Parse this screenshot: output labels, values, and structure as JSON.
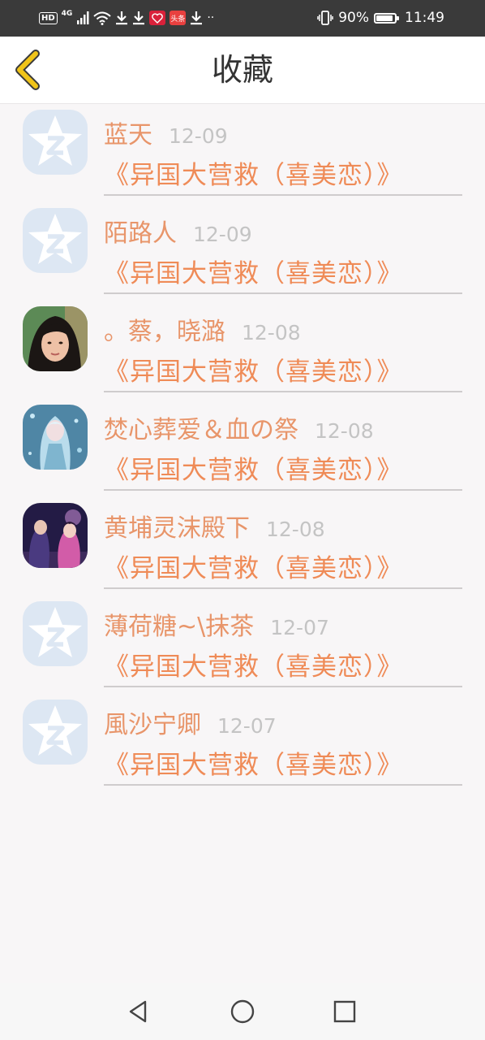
{
  "status": {
    "hd": "HD",
    "net": "4G",
    "app_badge": "头条",
    "dots": "··",
    "battery_percent": "90%",
    "battery_level": 0.9,
    "time": "11:49"
  },
  "header": {
    "title": "收藏",
    "back_icon": "chevron-left-icon"
  },
  "items": [
    {
      "name": "蓝天",
      "date": "12-09",
      "title": "《异国大营救（喜美恋）》",
      "avatar": "default-qq-star"
    },
    {
      "name": "陌路人",
      "date": "12-09",
      "title": "《异国大营救（喜美恋）》",
      "avatar": "default-qq-star"
    },
    {
      "name": "。蔡，晓潞",
      "date": "12-08",
      "title": "《异国大营救（喜美恋）》",
      "avatar": "photo-person"
    },
    {
      "name": "焚心葬爱＆血の祭",
      "date": "12-08",
      "title": "《异国大营救（喜美恋）》",
      "avatar": "photo-anime-blue"
    },
    {
      "name": "黄埔灵沫殿下",
      "date": "12-08",
      "title": "《异国大营救（喜美恋）》",
      "avatar": "photo-anime-night"
    },
    {
      "name": "薄荷糖~\\抹茶",
      "date": "12-07",
      "title": "《异国大营救（喜美恋）》",
      "avatar": "default-qq-star"
    },
    {
      "name": "風沙宁卿",
      "date": "12-07",
      "title": "《异国大营救（喜美恋）》",
      "avatar": "default-qq-star"
    }
  ],
  "colors": {
    "accent_name": "#e8956a",
    "accent_title": "#ef8b57",
    "date": "#c4c4c4",
    "back_icon": "#f0c419",
    "default_avatar_bg": "#dde7f3"
  },
  "navbar": {
    "back": "triangle-back-icon",
    "home": "circle-home-icon",
    "recents": "square-recents-icon"
  }
}
